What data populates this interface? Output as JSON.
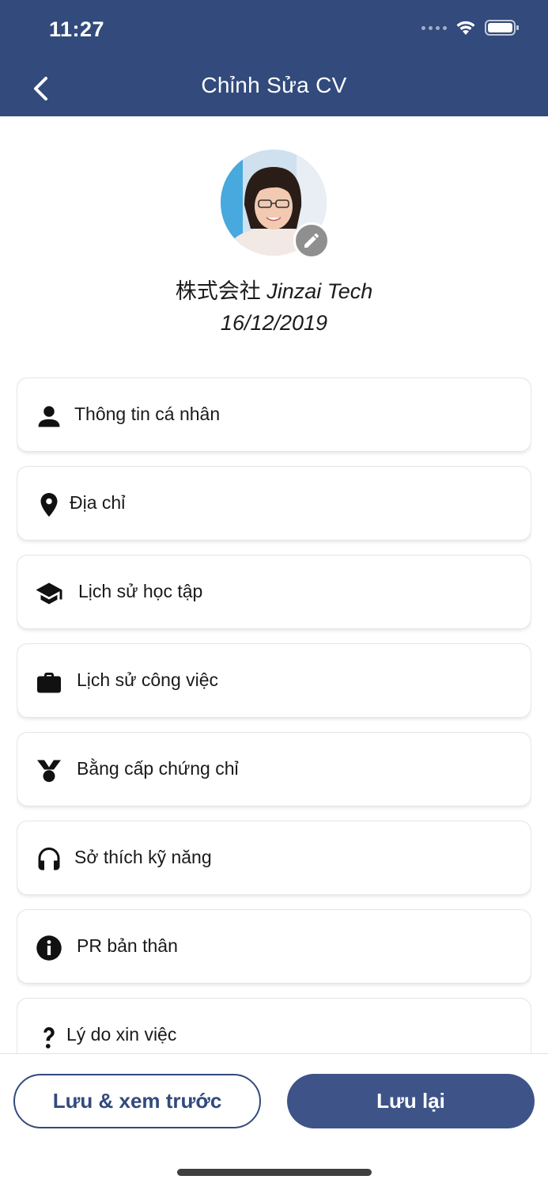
{
  "status_bar": {
    "time": "11:27"
  },
  "header": {
    "title": "Chỉnh Sửa CV"
  },
  "profile": {
    "company_prefix": "株式会社",
    "company_name": "Jinzai Tech",
    "date": "16/12/2019"
  },
  "menu": {
    "items": [
      {
        "label": "Thông tin cá nhân",
        "icon": "person-icon"
      },
      {
        "label": "Địa chỉ",
        "icon": "location-pin-icon"
      },
      {
        "label": "Lịch sử học tập",
        "icon": "graduation-cap-icon"
      },
      {
        "label": "Lịch sử công việc",
        "icon": "briefcase-icon"
      },
      {
        "label": "Bằng cấp chứng chỉ",
        "icon": "medal-icon"
      },
      {
        "label": "Sở thích kỹ năng",
        "icon": "headphones-icon"
      },
      {
        "label": "PR bản thân",
        "icon": "info-icon"
      },
      {
        "label": "Lý do xin việc",
        "icon": "question-icon"
      }
    ]
  },
  "footer": {
    "preview_label": "Lưu & xem trước",
    "save_label": "Lưu lại"
  },
  "colors": {
    "header_bg": "#324a7c",
    "primary_button": "#3e5488",
    "edit_badge": "#8f8f8f"
  }
}
